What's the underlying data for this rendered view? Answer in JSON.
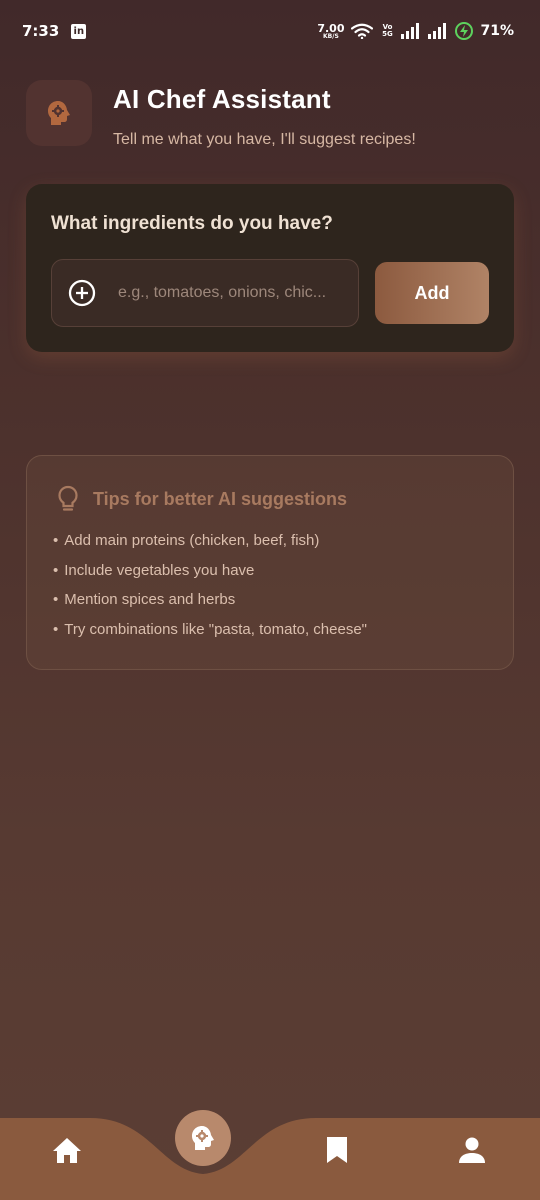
{
  "status_bar": {
    "time": "7:33",
    "linkedin_icon": "linkedin-icon",
    "net_speed_value": "7.00",
    "net_speed_unit": "KB/S",
    "volte_line1": "Vo",
    "volte_line2": "5G",
    "battery_percent": "71%",
    "battery_charging": true
  },
  "header": {
    "logo_icon": "head-gear-icon",
    "title": "AI Chef Assistant",
    "subtitle": "Tell me what you have, I'll suggest recipes!"
  },
  "ingredient_card": {
    "title": "What ingredients do you have?",
    "input_icon": "add-circle-icon",
    "input_placeholder": "e.g., tomatoes, onions, chic...",
    "add_button_label": "Add"
  },
  "tips": {
    "icon": "lightbulb-icon",
    "title": "Tips for better AI suggestions",
    "items": [
      "Add main proteins (chicken, beef, fish)",
      "Include vegetables you have",
      "Mention spices and herbs",
      "Try combinations like \"pasta, tomato, cheese\""
    ]
  },
  "bottom_nav": {
    "items": [
      "home-icon",
      "ai-chef-icon",
      "bookmark-icon",
      "profile-icon"
    ],
    "active_item": "ai-chef-icon"
  },
  "colors": {
    "background_top": "#41292a",
    "background_bottom": "#5b3e34",
    "card_dark": "#2e251d",
    "accent": "#a87a60",
    "nav_bar": "#8a5a3e",
    "nav_active": "#b8896c"
  }
}
